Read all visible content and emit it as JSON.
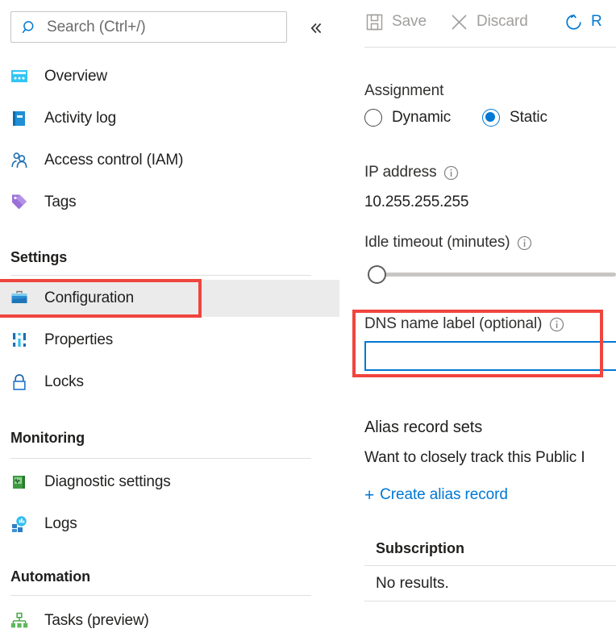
{
  "search": {
    "placeholder": "Search (Ctrl+/)",
    "icon": "search-icon"
  },
  "collapse_icon": "chevron-double-left-icon",
  "sidebar": {
    "items": [
      {
        "label": "Overview",
        "icon": "dashboard-window-icon",
        "selected": false
      },
      {
        "label": "Activity log",
        "icon": "activity-log-book-icon",
        "selected": false
      },
      {
        "label": "Access control (IAM)",
        "icon": "people-icon",
        "selected": false
      },
      {
        "label": "Tags",
        "icon": "tag-icon",
        "selected": false
      }
    ],
    "sections": [
      {
        "title": "Settings",
        "items": [
          {
            "label": "Configuration",
            "icon": "toolbox-icon",
            "selected": true
          },
          {
            "label": "Properties",
            "icon": "sliders-icon",
            "selected": false
          },
          {
            "label": "Locks",
            "icon": "padlock-icon",
            "selected": false
          }
        ]
      },
      {
        "title": "Monitoring",
        "items": [
          {
            "label": "Diagnostic settings",
            "icon": "diagnostic-book-icon",
            "selected": false
          },
          {
            "label": "Logs",
            "icon": "logs-chart-icon",
            "selected": false
          }
        ]
      },
      {
        "title": "Automation",
        "items": [
          {
            "label": "Tasks (preview)",
            "icon": "tasks-hierarchy-icon",
            "selected": false
          }
        ]
      }
    ]
  },
  "toolbar": {
    "save_label": "Save",
    "save_enabled": false,
    "discard_label": "Discard",
    "discard_enabled": false,
    "refresh_label": "R",
    "refresh_enabled": true
  },
  "main": {
    "assignment": {
      "label": "Assignment",
      "options": [
        {
          "label": "Dynamic",
          "selected": false
        },
        {
          "label": "Static",
          "selected": true
        }
      ]
    },
    "ip_address": {
      "label": "IP address",
      "value": "10.255.255.255",
      "info_icon": "info-circle-icon"
    },
    "idle_timeout": {
      "label": "Idle timeout (minutes)",
      "info_icon": "info-circle-icon",
      "value": 4,
      "min": 4,
      "max": 30
    },
    "dns_name_label": {
      "label": "DNS name label (optional)",
      "info_icon": "info-circle-icon",
      "value": "",
      "placeholder": ""
    },
    "alias_record_sets": {
      "title": "Alias record sets",
      "description": "Want to closely track this Public I",
      "create_link": "Create alias record",
      "plus_icon": "plus-icon"
    },
    "subscription_table": {
      "header": "Subscription",
      "empty_text": "No results."
    }
  },
  "colors": {
    "accent": "#0078d4",
    "annotation": "#f0453e",
    "selected_row": "#ebebeb",
    "disabled_text": "#a19f9d",
    "divider": "#e1dfdd"
  }
}
